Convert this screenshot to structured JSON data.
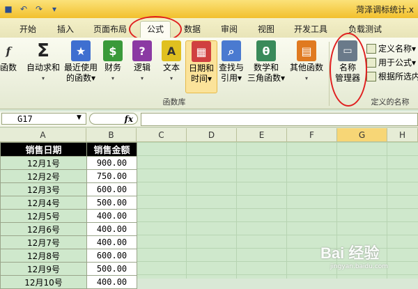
{
  "titlebar": {
    "title": "菏泽调标统计.x"
  },
  "tabs": [
    "开始",
    "插入",
    "页面布局",
    "公式",
    "数据",
    "审阅",
    "视图",
    "开发工具",
    "负载测试"
  ],
  "ribbon": {
    "buttons": [
      {
        "label1": "函数",
        "label2": "",
        "icon": "fx-icon",
        "color": "#c8a040"
      },
      {
        "label1": "自动求和",
        "label2": "▾",
        "icon": "sigma-icon",
        "color": "#222222"
      },
      {
        "label1": "最近使用",
        "label2": "的函数▾",
        "icon": "star-book-icon",
        "color": "#3f6fd0"
      },
      {
        "label1": "财务",
        "label2": "▾",
        "icon": "finance-book-icon",
        "color": "#3a9a3a"
      },
      {
        "label1": "逻辑",
        "label2": "▾",
        "icon": "logic-book-icon",
        "color": "#8b3aa3"
      },
      {
        "label1": "文本",
        "label2": "▾",
        "icon": "text-book-icon",
        "color": "#e0c020"
      },
      {
        "label1": "日期和",
        "label2": "时间▾",
        "icon": "date-book-icon",
        "color": "#d04040"
      },
      {
        "label1": "查找与",
        "label2": "引用▾",
        "icon": "lookup-book-icon",
        "color": "#4a7ad0"
      },
      {
        "label1": "数学和",
        "label2": "三角函数▾",
        "icon": "math-book-icon",
        "color": "#3a8a5a"
      },
      {
        "label1": "其他函数",
        "label2": "▾",
        "icon": "more-book-icon",
        "color": "#e07a20"
      },
      {
        "label1": "名称",
        "label2": "管理器",
        "icon": "name-manager-icon",
        "color": "#6a7a8a"
      }
    ],
    "group_functions": "函数库",
    "group_names": "定义的名称",
    "small": [
      "定义名称▾",
      "用于公式▾",
      "根据所选内容"
    ]
  },
  "formula": {
    "namebox": "G17",
    "fx": "fx"
  },
  "columns": [
    "A",
    "B",
    "C",
    "D",
    "E",
    "F",
    "G",
    "H"
  ],
  "table": {
    "header": [
      "销售日期",
      "销售金额"
    ],
    "rows": [
      [
        "12月1号",
        "900.00"
      ],
      [
        "12月2号",
        "750.00"
      ],
      [
        "12月3号",
        "600.00"
      ],
      [
        "12月4号",
        "500.00"
      ],
      [
        "12月5号",
        "400.00"
      ],
      [
        "12月6号",
        "400.00"
      ],
      [
        "12月7号",
        "400.00"
      ],
      [
        "12月8号",
        "600.00"
      ],
      [
        "12月9号",
        "500.00"
      ],
      [
        "12月10号",
        "400.00"
      ]
    ]
  },
  "watermark": {
    "main": "Bai 经验",
    "sub": "jingyan.baidu.com"
  }
}
